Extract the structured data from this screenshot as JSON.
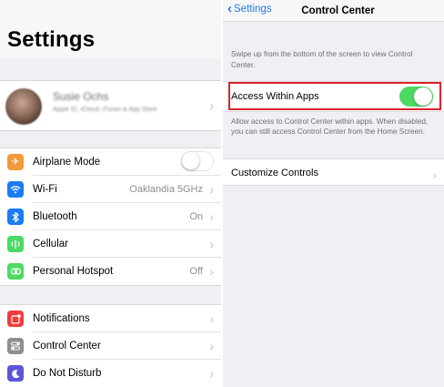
{
  "left": {
    "title": "Settings",
    "profile": {
      "name": "Susie Ochs",
      "subtitle": "Apple ID, iCloud, iTunes & App Store"
    },
    "group1": [
      {
        "label": "Airplane Mode",
        "value": "",
        "icon": "airplane-icon",
        "color": "#f19a37",
        "toggle": false
      },
      {
        "label": "Wi-Fi",
        "value": "Oaklandia 5GHz",
        "icon": "wifi-icon",
        "color": "#1a7cf5"
      },
      {
        "label": "Bluetooth",
        "value": "On",
        "icon": "bluetooth-icon",
        "color": "#1a7cf5"
      },
      {
        "label": "Cellular",
        "value": "",
        "icon": "cellular-icon",
        "color": "#4cd964"
      },
      {
        "label": "Personal Hotspot",
        "value": "Off",
        "icon": "hotspot-icon",
        "color": "#4cd964"
      }
    ],
    "group2": [
      {
        "label": "Notifications",
        "value": "",
        "icon": "notifications-icon",
        "color": "#f03c3c"
      },
      {
        "label": "Control Center",
        "value": "",
        "icon": "control-center-icon",
        "color": "#8e8e93"
      },
      {
        "label": "Do Not Disturb",
        "value": "",
        "icon": "moon-icon",
        "color": "#5b56d6"
      }
    ]
  },
  "right": {
    "back_label": "Settings",
    "nav_title": "Control Center",
    "help_top": "Swipe up from the bottom of the screen to view Control Center.",
    "access_label": "Access Within Apps",
    "access_on": true,
    "help_mid": "Allow access to Control Center within apps. When disabled, you can still access Control Center from the Home Screen.",
    "customize_label": "Customize Controls"
  },
  "colors": {
    "accent": "#1a7cf5",
    "toggle_on": "#4cd964",
    "highlight": "#d9232d"
  }
}
